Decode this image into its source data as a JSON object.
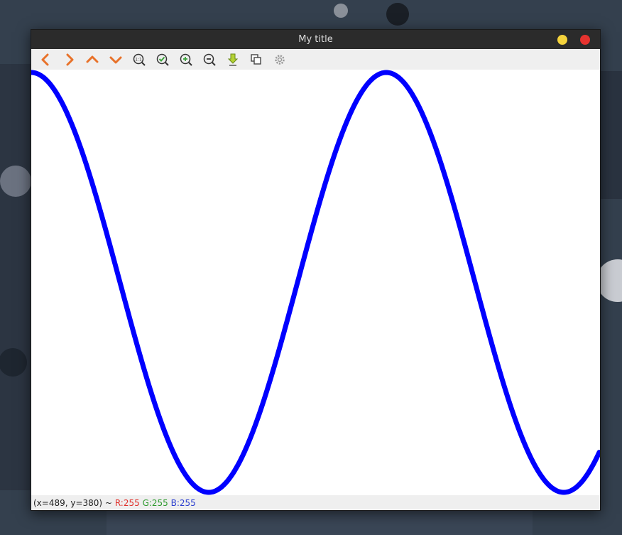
{
  "window": {
    "title": "My title"
  },
  "toolbar": {
    "buttons": [
      {
        "name": "pan-left",
        "icon": "chevron-left-icon"
      },
      {
        "name": "pan-right",
        "icon": "chevron-right-icon"
      },
      {
        "name": "pan-up",
        "icon": "chevron-up-icon"
      },
      {
        "name": "pan-down",
        "icon": "chevron-down-icon"
      },
      {
        "name": "zoom-original",
        "icon": "zoom-1to1-icon"
      },
      {
        "name": "zoom-fit",
        "icon": "zoom-check-icon"
      },
      {
        "name": "zoom-in",
        "icon": "zoom-in-icon"
      },
      {
        "name": "zoom-out",
        "icon": "zoom-out-icon"
      },
      {
        "name": "save",
        "icon": "download-arrow-icon"
      },
      {
        "name": "copy",
        "icon": "copy-icon"
      },
      {
        "name": "properties",
        "icon": "gear-icon"
      }
    ]
  },
  "status": {
    "coords": "(x=489, y=380) ~",
    "r": "R:255",
    "g": "G:255",
    "b": "B:255"
  },
  "plot": {
    "line_color": "#0000ff",
    "background": "#ffffff"
  },
  "colors": {
    "accent_orange": "#e8722a",
    "status_r": "#e0302a",
    "status_g": "#2f9a2f",
    "status_b": "#2c3fcf"
  }
}
